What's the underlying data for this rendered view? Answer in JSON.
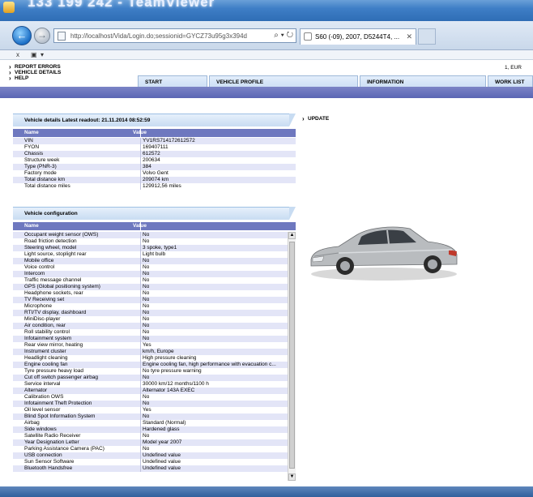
{
  "window": {
    "title": "133 199 242 - TeamViewer"
  },
  "browser": {
    "url": "http://localhost/Vida/Login.do;sessionid=GYCZ73u95g3x394d",
    "tab_title": "S60 (-09), 2007, D5244T4, ...",
    "cmd_x": "x",
    "cmd_menu": "▾"
  },
  "vida": {
    "menu": [
      "REPORT ERRORS",
      "VEHICLE DETAILS",
      "HELP"
    ],
    "locale": "1, EUR",
    "tabs": [
      "START",
      "VEHICLE PROFILE",
      "INFORMATION",
      "WORK LIST"
    ],
    "update_label": "UPDATE"
  },
  "details": {
    "title": "Vehicle details   Latest readout: 21.11.2014 08:52:59",
    "col_name": "Name",
    "col_value": "Value",
    "rows": [
      [
        "VIN",
        "YV1RS714172612572"
      ],
      [
        "FYON",
        "169407111"
      ],
      [
        "Chassis",
        "612572"
      ],
      [
        "Structure week",
        "200634"
      ],
      [
        "Type (PNR-3)",
        "384"
      ],
      [
        "Factory mode",
        "Volvo Gent"
      ],
      [
        "Total distance km",
        "209074 km"
      ],
      [
        "Total distance miles",
        "129912,56 miles"
      ]
    ]
  },
  "config": {
    "title": "Vehicle configuration",
    "col_name": "Name",
    "col_value": "Value",
    "rows": [
      [
        "Occupant weight sensor (OWS)",
        "No"
      ],
      [
        "Road friction detection",
        "No"
      ],
      [
        "Steering wheel, model",
        "3 spoke, type1"
      ],
      [
        "Light source, stoplight rear",
        "Light bulb"
      ],
      [
        "Mobile office",
        "No"
      ],
      [
        "Voice control",
        "No"
      ],
      [
        "Intercom",
        "No"
      ],
      [
        "Traffic message channel",
        "No"
      ],
      [
        "GPS (Global positioning system)",
        "No"
      ],
      [
        "Headphone sockets, rear",
        "No"
      ],
      [
        "TV Receiving set",
        "No"
      ],
      [
        "Microphone",
        "No"
      ],
      [
        "RTI/TV display, dashboard",
        "No"
      ],
      [
        "MiniDisc-player",
        "No"
      ],
      [
        "Air condition, rear",
        "No"
      ],
      [
        "Roll stability control",
        "No"
      ],
      [
        "Infotainment system",
        "No"
      ],
      [
        "Rear view mirror, heating",
        "Yes"
      ],
      [
        "Instrument cluster",
        "km/h, Europe"
      ],
      [
        "Headlight cleaning",
        "High pressure cleaning"
      ],
      [
        "Engine cooling fan",
        "Engine cooling fan, high performance with evacuation c..."
      ],
      [
        "Tyre pressure heavy load",
        "No tyre pressure warning"
      ],
      [
        "Cut off switch passenger airbag",
        "No"
      ],
      [
        "Service interval",
        "30000 km/12 months/1100 h"
      ],
      [
        "Alternator",
        "Alternator 143A EXEC"
      ],
      [
        "Calibration OWS",
        "No"
      ],
      [
        "Infotainment Theft Protection",
        "No"
      ],
      [
        "Oil level sensor",
        "Yes"
      ],
      [
        "Blind Spot Information System",
        "No"
      ],
      [
        "Airbag",
        "Standard (Normal)"
      ],
      [
        "Side windows",
        "Hardened glass"
      ],
      [
        "Satellite Radio Receiver",
        "No"
      ],
      [
        "Year Designation Letter",
        "Model year 2007"
      ],
      [
        "Parking Assistance Camera (PAC)",
        "No"
      ],
      [
        "USB connection",
        "Undefined value"
      ],
      [
        "Sun Sensor Software",
        "Undefined value"
      ],
      [
        "Bluetooth Handsfree",
        "Undefined value"
      ]
    ]
  }
}
